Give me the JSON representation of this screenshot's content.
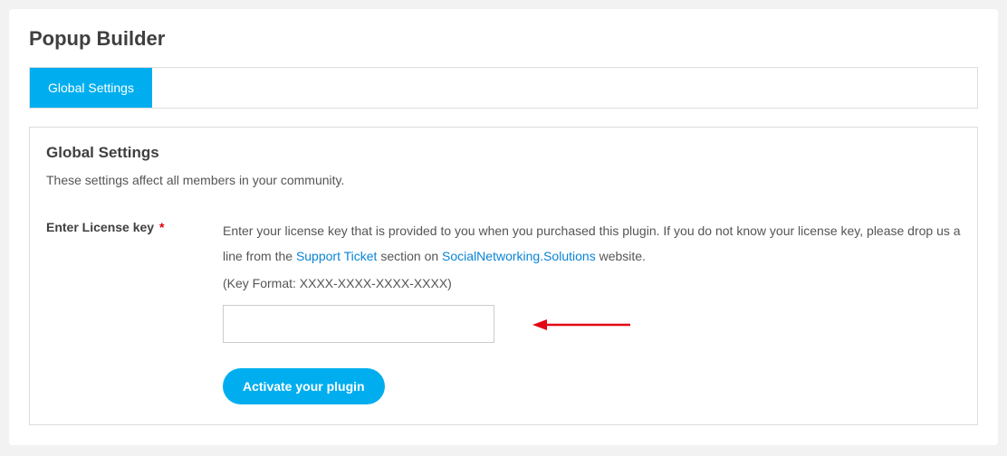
{
  "page": {
    "title": "Popup Builder"
  },
  "tabs": {
    "items": [
      {
        "label": "Global Settings"
      }
    ]
  },
  "panel": {
    "title": "Global Settings",
    "description": "These settings affect all members in your community."
  },
  "license": {
    "label": "Enter License key",
    "required_marker": "*",
    "help_pre": "Enter your license key that is provided to you when you purchased this plugin. If you do not know your license key, please drop us a line from the ",
    "support_link": "Support Ticket",
    "help_mid": " section on ",
    "site_link": "SocialNetworking.Solutions",
    "help_post": " website.",
    "key_format": "(Key Format: XXXX-XXXX-XXXX-XXXX)",
    "value": ""
  },
  "actions": {
    "activate_label": "Activate your plugin"
  }
}
